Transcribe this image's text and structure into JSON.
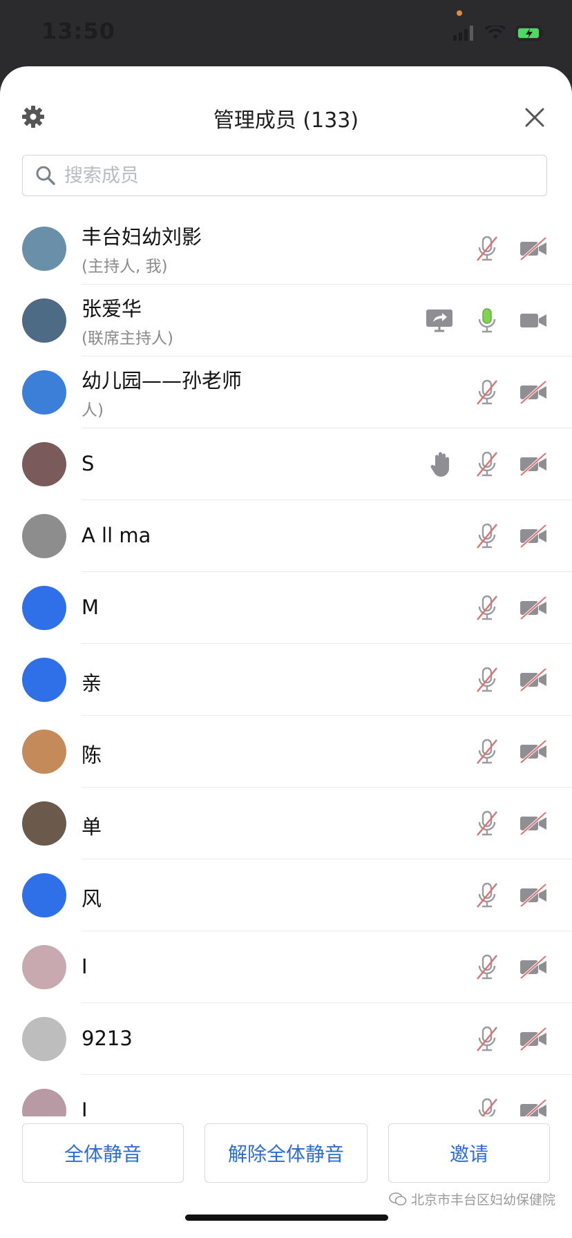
{
  "status_bar": {
    "time": "13:50"
  },
  "header": {
    "title": "管理成员 (133)"
  },
  "search": {
    "placeholder": "搜索成员"
  },
  "members": [
    {
      "name": "丰台妇幼刘影",
      "role": "(主持人, 我)",
      "avatar_color": "#6a8fa8",
      "mic": "muted",
      "cam": "off",
      "extra": ""
    },
    {
      "name": "张爱华",
      "role": "(联席主持人)",
      "avatar_color": "#4e6b86",
      "mic": "active",
      "cam": "on",
      "extra": "screen-share"
    },
    {
      "name": "幼儿园——孙老师",
      "role": "人)",
      "avatar_color": "#3b7fd8",
      "mic": "muted",
      "cam": "off",
      "extra": ""
    },
    {
      "name": "S",
      "role": "",
      "avatar_color": "#7a5a5a",
      "mic": "muted",
      "cam": "off",
      "extra": "raise-hand"
    },
    {
      "name": "A ll ma",
      "role": "",
      "avatar_color": "#8d8d8d",
      "mic": "muted",
      "cam": "off",
      "extra": ""
    },
    {
      "name": "M",
      "role": "",
      "avatar_color": "#2f6fe8",
      "mic": "muted",
      "cam": "off",
      "extra": ""
    },
    {
      "name": "亲",
      "role": "",
      "avatar_color": "#2f6fe8",
      "mic": "muted",
      "cam": "off",
      "extra": ""
    },
    {
      "name": "陈",
      "role": "",
      "avatar_color": "#c58a5a",
      "mic": "muted",
      "cam": "off",
      "extra": ""
    },
    {
      "name": "单",
      "role": "",
      "avatar_color": "#6b5a4c",
      "mic": "muted",
      "cam": "off",
      "extra": ""
    },
    {
      "name": "风",
      "role": "",
      "avatar_color": "#2f6fe8",
      "mic": "muted",
      "cam": "off",
      "extra": ""
    },
    {
      "name": "I",
      "role": "",
      "avatar_color": "#c9a9b0",
      "mic": "muted",
      "cam": "off",
      "extra": ""
    },
    {
      "name": "9213",
      "role": "",
      "avatar_color": "#bdbdbd",
      "mic": "muted",
      "cam": "off",
      "extra": ""
    },
    {
      "name": "I",
      "role": "",
      "avatar_color": "#b89aa5",
      "mic": "muted",
      "cam": "off",
      "extra": ""
    }
  ],
  "footer": {
    "mute_all_label": "全体静音",
    "unmute_all_label": "解除全体静音",
    "invite_label": "邀请"
  },
  "watermark": {
    "text": "北京市丰台区妇幼保健院"
  },
  "colors": {
    "accent": "#2d6dd2",
    "mic_active": "#7ed34f",
    "muted_slash": "#e07070",
    "icon_gray": "#8e8e93"
  },
  "icons": [
    "gear-icon",
    "close-icon",
    "search-icon",
    "mic-muted-icon",
    "mic-active-icon",
    "camera-off-icon",
    "camera-on-icon",
    "screen-share-icon",
    "raise-hand-icon"
  ]
}
